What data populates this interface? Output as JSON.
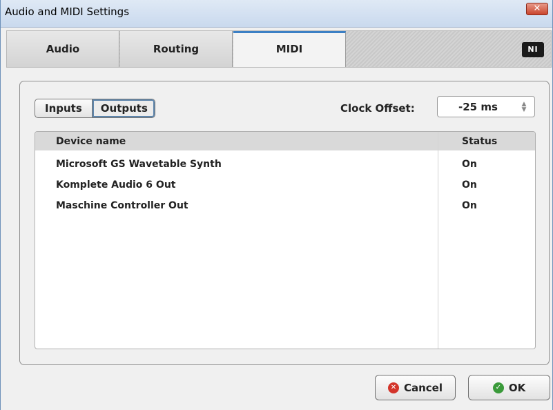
{
  "window": {
    "title": "Audio and MIDI Settings"
  },
  "tabs": [
    {
      "label": "Audio",
      "active": false
    },
    {
      "label": "Routing",
      "active": false
    },
    {
      "label": "MIDI",
      "active": true
    }
  ],
  "logo": {
    "text": "NI"
  },
  "segmented": {
    "inputs_label": "Inputs",
    "outputs_label": "Outputs",
    "selected": "Outputs"
  },
  "clock": {
    "label": "Clock Offset:",
    "value": "-25 ms"
  },
  "table": {
    "columns": [
      "Device name",
      "Status"
    ],
    "rows": [
      {
        "device": "Microsoft GS Wavetable Synth",
        "status": "On"
      },
      {
        "device": "Komplete Audio 6 Out",
        "status": "On"
      },
      {
        "device": "Maschine Controller Out",
        "status": "On"
      }
    ]
  },
  "buttons": {
    "cancel_label": "Cancel",
    "ok_label": "OK"
  },
  "colors": {
    "active_tab_accent": "#3b7fc4",
    "cancel_icon": "#d3342a",
    "ok_icon": "#3a9a3a"
  }
}
